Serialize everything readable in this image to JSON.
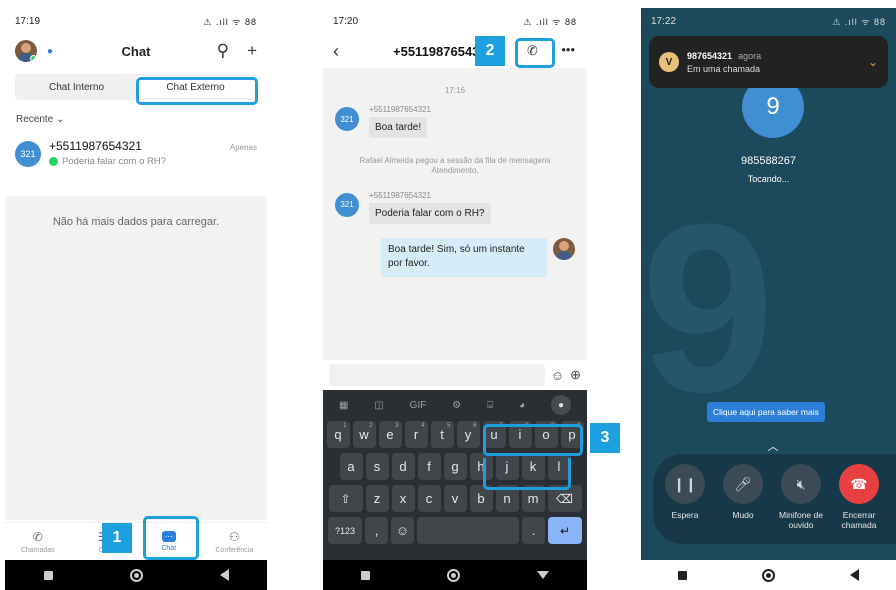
{
  "phone1": {
    "status": {
      "time": "17:19",
      "icons": "⚠ .ıll ᯤ 88"
    },
    "header": {
      "title": "Chat"
    },
    "tabs": {
      "internal": "Chat Interno",
      "external": "Chat Externo"
    },
    "recent_label": "Recente ⌄",
    "chat_item": {
      "badge": "321",
      "name": "+5511987654321",
      "time": "Apenas",
      "preview": "Poderia falar com o RH?"
    },
    "empty_message": "Não há mais dados para carregar.",
    "bottom_tabs": {
      "calls": "Chamadas",
      "contacts": "Co",
      "chat": "Chat",
      "conference": "Conferência"
    },
    "callout": "1"
  },
  "phone2": {
    "status": {
      "time": "17:20",
      "icons": "⚠ .ıll ᯤ 88"
    },
    "header": {
      "title": "+5511987654321"
    },
    "timestamp": "17:16",
    "messages": [
      {
        "number": "+5511987654321",
        "text": "Boa tarde!"
      },
      {
        "number": "+5511987654321",
        "text": "Poderia falar com o RH?"
      }
    ],
    "system_message": "Rafael Almeida pegou a sessão da fila de mensagens Atendimento.",
    "outgoing": "Boa tarde! Sim, só um instante por favor.",
    "badge": "321",
    "keyboard": {
      "tools": [
        "GIF"
      ],
      "row1": [
        "q",
        "w",
        "e",
        "r",
        "t",
        "y",
        "u",
        "i",
        "o",
        "p"
      ],
      "row1_sup": [
        "1",
        "2",
        "3",
        "4",
        "5",
        "6",
        "7",
        "8",
        "9",
        "0"
      ],
      "row2": [
        "a",
        "s",
        "d",
        "f",
        "g",
        "h",
        "j",
        "k",
        "l"
      ],
      "row3": [
        "z",
        "x",
        "c",
        "v",
        "b",
        "n",
        "m"
      ],
      "sym": "?123",
      "comma": ",",
      "period": "."
    },
    "callout2": "2",
    "callout3": "3"
  },
  "phone3": {
    "status": {
      "time": "17:22",
      "icons": "⚠ .ıll ᯤ 88"
    },
    "notification": {
      "number": "987654321",
      "ago": "agora",
      "text": "Em uma chamada"
    },
    "call": {
      "digit": "9",
      "number": "985588267",
      "status": "Tocando..."
    },
    "tip": "Clique aqui para saber mais",
    "controls": {
      "hold": "Espera",
      "mute": "Mudo",
      "earpiece": "Minifone de ouvido",
      "end": "Encerrar chamada"
    }
  }
}
